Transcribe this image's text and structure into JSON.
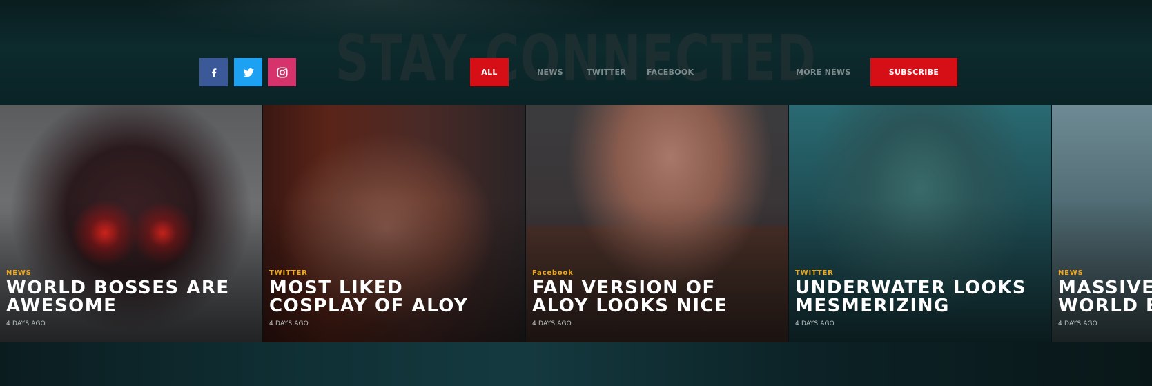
{
  "header": {
    "title": "STAY CONNECTED"
  },
  "social": [
    {
      "name": "facebook",
      "icon": "facebook-icon",
      "color": "#3b5998"
    },
    {
      "name": "twitter",
      "icon": "twitter-icon",
      "color": "#1da1f2"
    },
    {
      "name": "instagram",
      "icon": "instagram-icon",
      "color": "#d6336c"
    }
  ],
  "filters": {
    "all": "ALL",
    "news": "NEWS",
    "twitter": "TWITTER",
    "facebook": "FACEBOOK",
    "more": "MORE NEWS"
  },
  "subscribe_label": "SUBSCRIBE",
  "colors": {
    "accent_red": "#d60f17",
    "category_orange": "#f0a81b"
  },
  "cards": [
    {
      "category": "NEWS",
      "line1": "WORLD BOSSES ARE",
      "line2": "AWESOME",
      "time": "4 DAYS AGO"
    },
    {
      "category": "TWITTER",
      "line1": "MOST LIKED",
      "line2": "COSPLAY OF ALOY",
      "time": "4 DAYS AGO"
    },
    {
      "category": "Facebook",
      "line1": "FAN VERSION OF",
      "line2": "ALOY LOOKS NICE",
      "time": "4 DAYS AGO"
    },
    {
      "category": "TWITTER",
      "line1": "UNDERWATER LOOKS",
      "line2": "MESMERIZING",
      "time": "4 DAYS AGO"
    },
    {
      "category": "NEWS",
      "line1": "MASSIVE",
      "line2": "WORLD B",
      "time": "4 DAYS AGO"
    }
  ]
}
